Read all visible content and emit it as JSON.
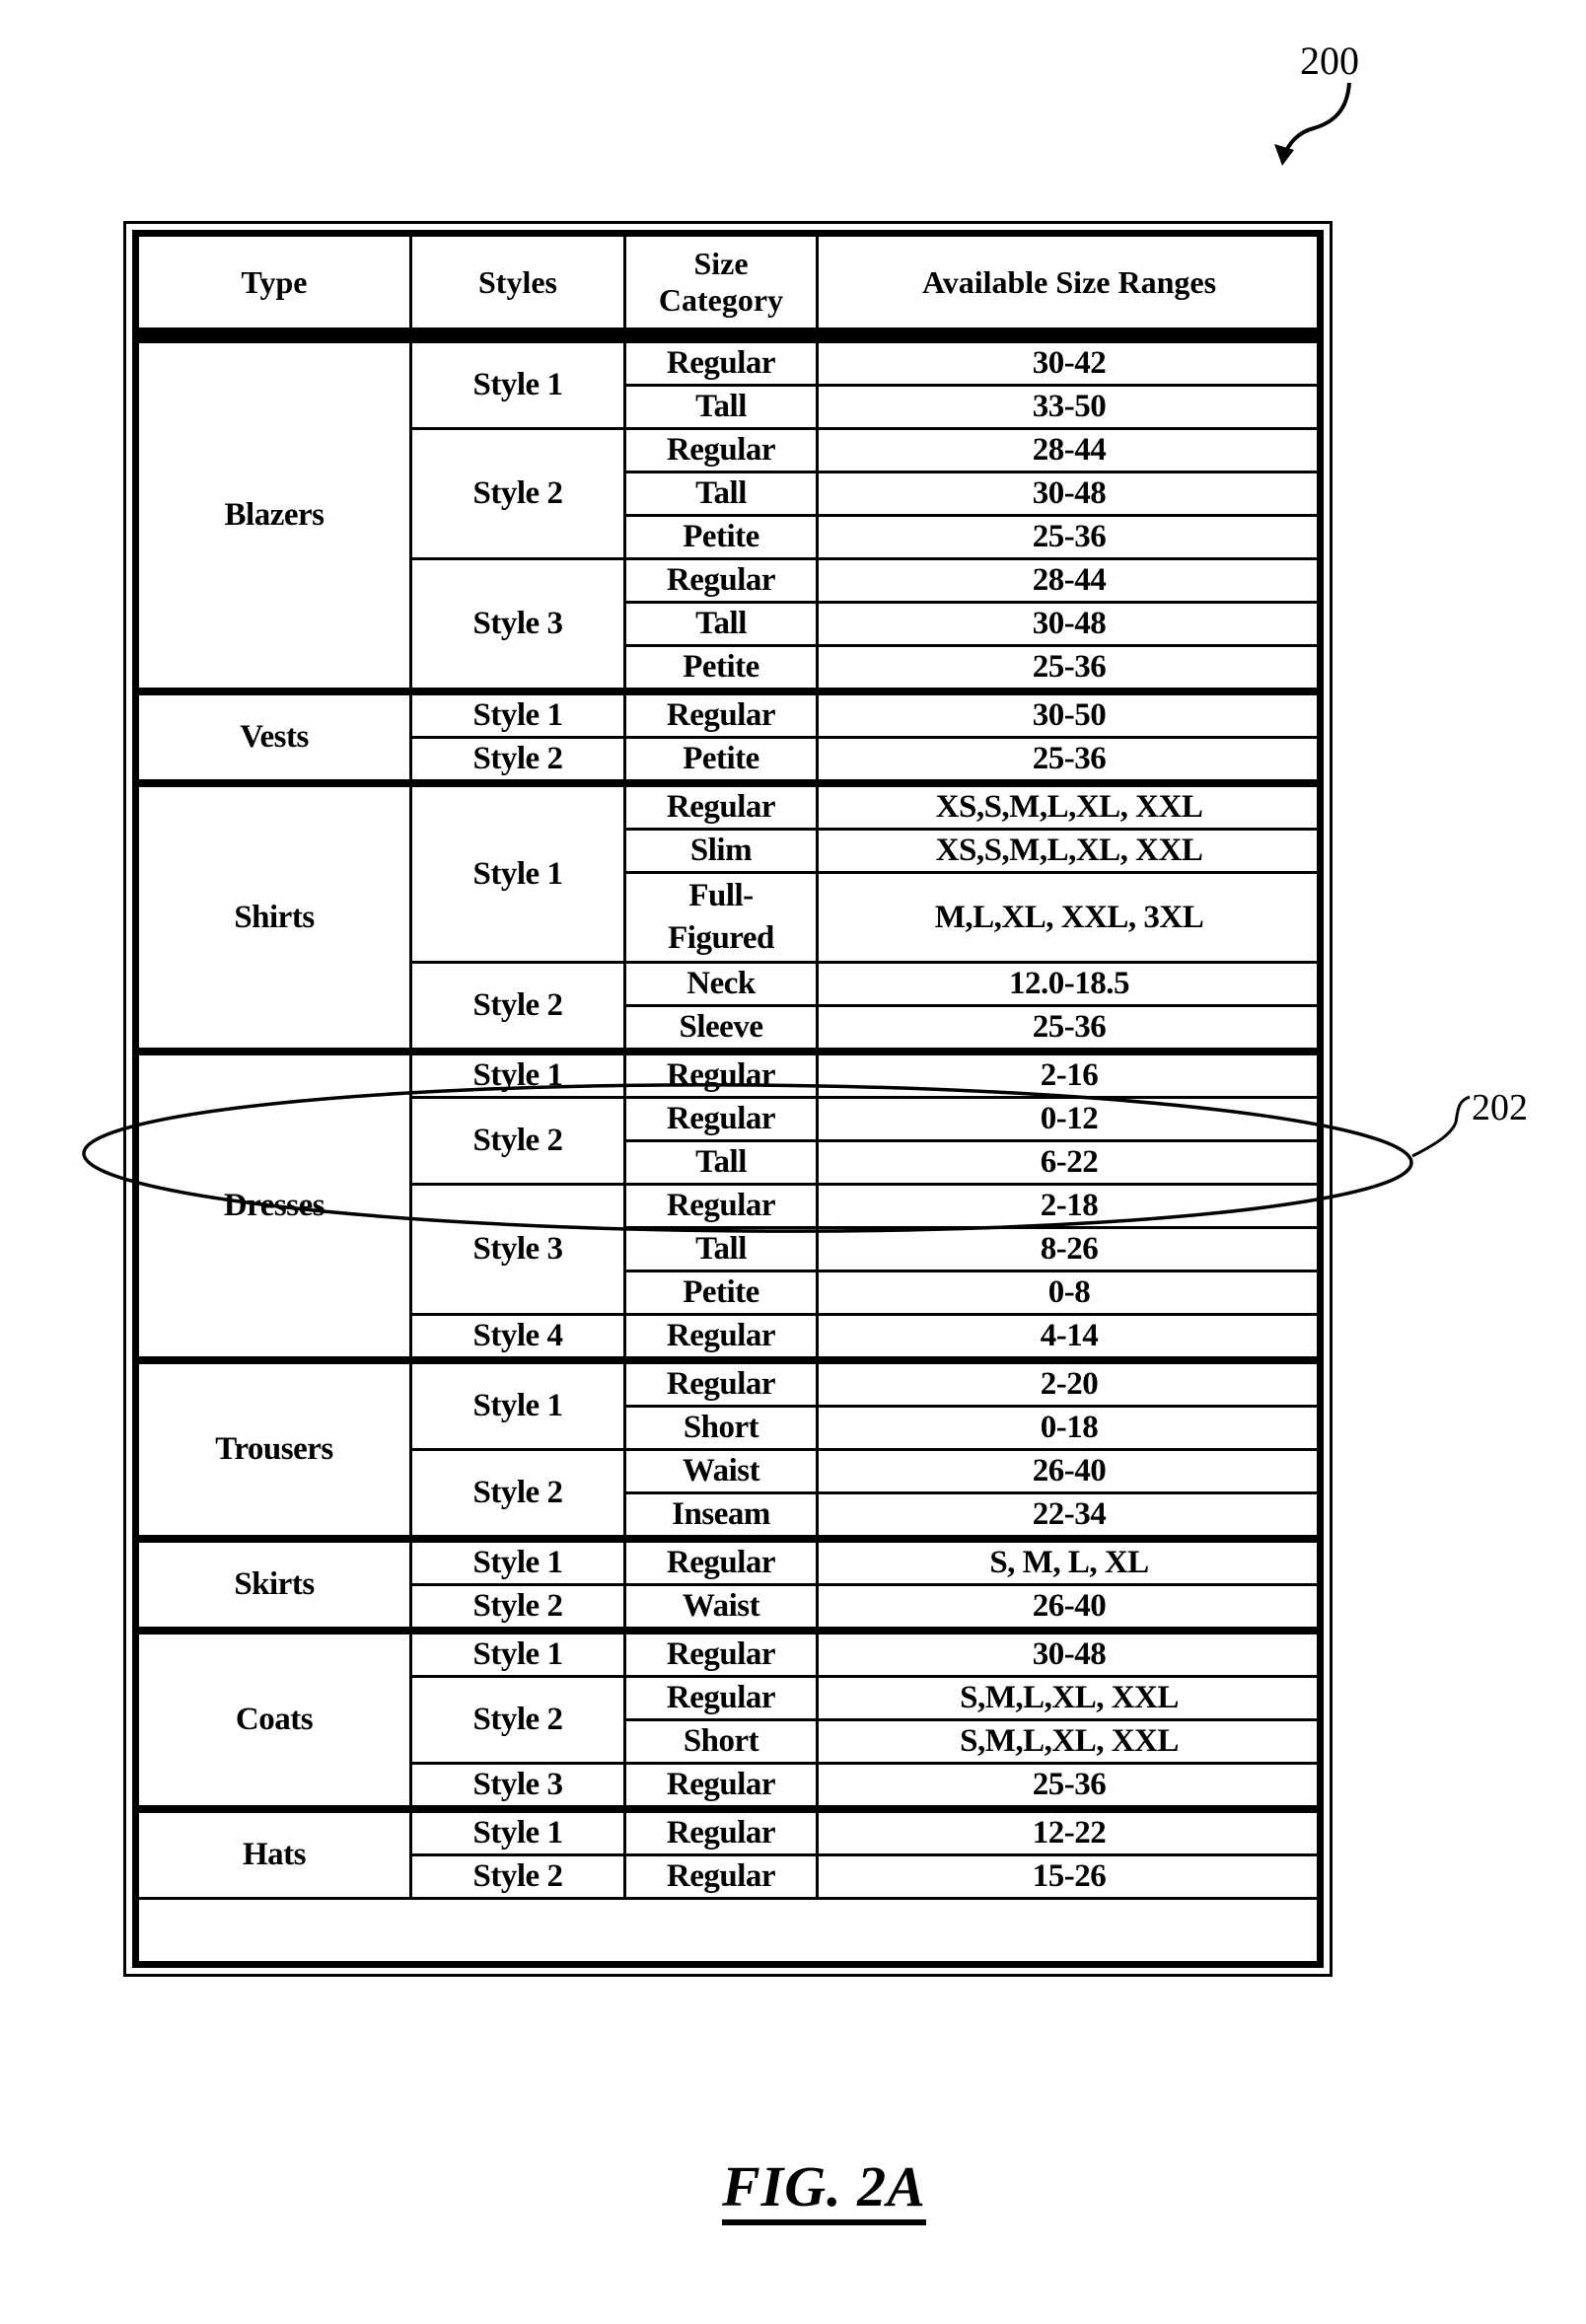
{
  "figure": {
    "reference_number": "200",
    "callout_number": "202",
    "caption": "FIG. 2A"
  },
  "table": {
    "headers": [
      "Type",
      "Styles",
      "Size Category",
      "Available Size Ranges"
    ],
    "groups": [
      {
        "type": "Blazers",
        "styles": [
          {
            "style": "Style 1",
            "rows": [
              {
                "category": "Regular",
                "range": "30-42"
              },
              {
                "category": "Tall",
                "range": "33-50"
              }
            ]
          },
          {
            "style": "Style 2",
            "rows": [
              {
                "category": "Regular",
                "range": "28-44"
              },
              {
                "category": "Tall",
                "range": "30-48"
              },
              {
                "category": "Petite",
                "range": "25-36"
              }
            ]
          },
          {
            "style": "Style 3",
            "rows": [
              {
                "category": "Regular",
                "range": "28-44"
              },
              {
                "category": "Tall",
                "range": "30-48"
              },
              {
                "category": "Petite",
                "range": "25-36"
              }
            ]
          }
        ]
      },
      {
        "type": "Vests",
        "styles": [
          {
            "style": "Style 1",
            "rows": [
              {
                "category": "Regular",
                "range": "30-50"
              }
            ]
          },
          {
            "style": "Style 2",
            "rows": [
              {
                "category": "Petite",
                "range": "25-36"
              }
            ]
          }
        ]
      },
      {
        "type": "Shirts",
        "styles": [
          {
            "style": "Style 1",
            "rows": [
              {
                "category": "Regular",
                "range": "XS,S,M,L,XL, XXL"
              },
              {
                "category": "Slim",
                "range": "XS,S,M,L,XL, XXL"
              },
              {
                "category": "Full-Figured",
                "range": "M,L,XL, XXL, 3XL",
                "tall": true
              }
            ]
          },
          {
            "style": "Style 2",
            "rows": [
              {
                "category": "Neck",
                "range": "12.0-18.5"
              },
              {
                "category": "Sleeve",
                "range": "25-36"
              }
            ]
          }
        ]
      },
      {
        "type": "Dresses",
        "styles": [
          {
            "style": "Style 1",
            "rows": [
              {
                "category": "Regular",
                "range": "2-16"
              }
            ]
          },
          {
            "style": "Style 2",
            "rows": [
              {
                "category": "Regular",
                "range": "0-12"
              },
              {
                "category": "Tall",
                "range": "6-22"
              }
            ]
          },
          {
            "style": "Style 3",
            "rows": [
              {
                "category": "Regular",
                "range": "2-18"
              },
              {
                "category": "Tall",
                "range": "8-26"
              },
              {
                "category": "Petite",
                "range": "0-8"
              }
            ]
          },
          {
            "style": "Style 4",
            "rows": [
              {
                "category": "Regular",
                "range": "4-14"
              }
            ]
          }
        ]
      },
      {
        "type": "Trousers",
        "styles": [
          {
            "style": "Style 1",
            "rows": [
              {
                "category": "Regular",
                "range": "2-20"
              },
              {
                "category": "Short",
                "range": "0-18"
              }
            ]
          },
          {
            "style": "Style 2",
            "rows": [
              {
                "category": "Waist",
                "range": "26-40"
              },
              {
                "category": "Inseam",
                "range": "22-34"
              }
            ]
          }
        ]
      },
      {
        "type": "Skirts",
        "styles": [
          {
            "style": "Style 1",
            "rows": [
              {
                "category": "Regular",
                "range": "S, M, L, XL"
              }
            ]
          },
          {
            "style": "Style 2",
            "rows": [
              {
                "category": "Waist",
                "range": "26-40"
              }
            ]
          }
        ]
      },
      {
        "type": "Coats",
        "styles": [
          {
            "style": "Style 1",
            "rows": [
              {
                "category": "Regular",
                "range": "30-48"
              }
            ]
          },
          {
            "style": "Style 2",
            "rows": [
              {
                "category": "Regular",
                "range": "S,M,L,XL, XXL"
              },
              {
                "category": "Short",
                "range": "S,M,L,XL, XXL"
              }
            ]
          },
          {
            "style": "Style 3",
            "rows": [
              {
                "category": "Regular",
                "range": "25-36"
              }
            ]
          }
        ]
      },
      {
        "type": "Hats",
        "styles": [
          {
            "style": "Style 1",
            "rows": [
              {
                "category": "Regular",
                "range": "12-22"
              }
            ]
          },
          {
            "style": "Style 2",
            "rows": [
              {
                "category": "Regular",
                "range": "15-26"
              }
            ]
          }
        ]
      }
    ]
  }
}
